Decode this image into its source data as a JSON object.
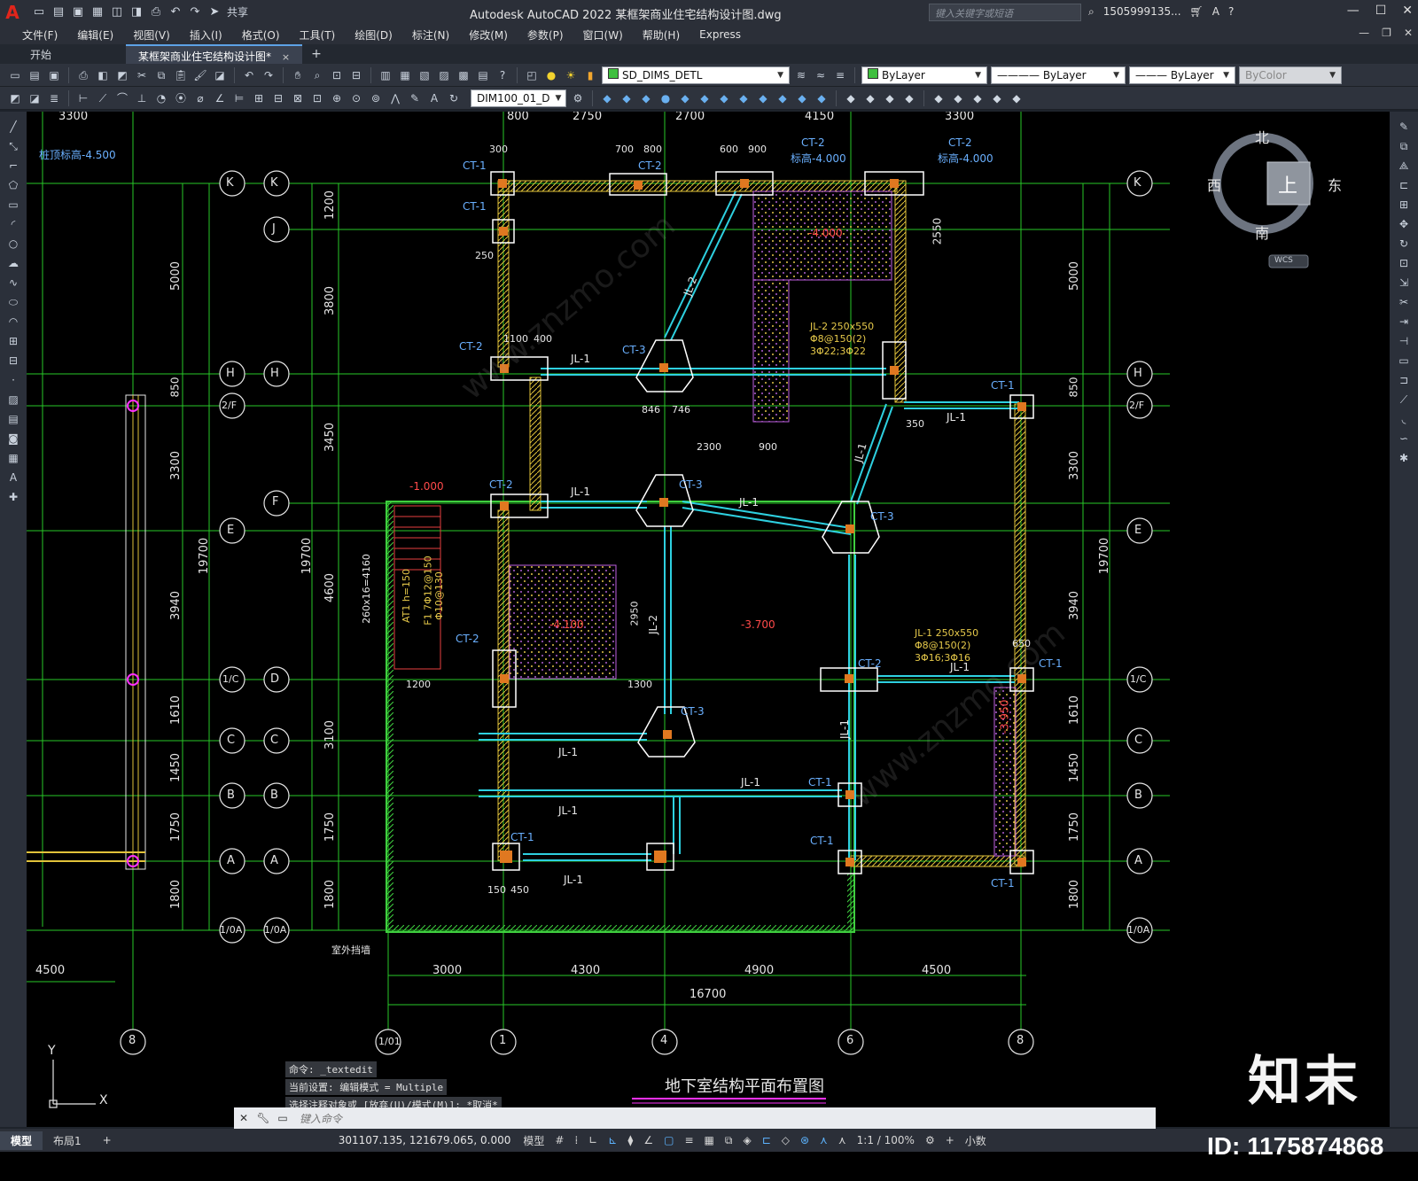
{
  "titlebar": {
    "app_icon": "A",
    "share_label": "共享",
    "title": "Autodesk AutoCAD 2022    某框架商业住宅结构设计图.dwg",
    "search_placeholder": "键入关键字或短语",
    "user": "1505999135...",
    "icons": [
      "new-icon",
      "open-icon",
      "save-icon",
      "saveas-icon",
      "web-open-icon",
      "web-save-icon",
      "print-icon",
      "undo-icon",
      "redo-icon",
      "share-icon"
    ]
  },
  "menu": {
    "items": [
      "文件(F)",
      "编辑(E)",
      "视图(V)",
      "插入(I)",
      "格式(O)",
      "工具(T)",
      "绘图(D)",
      "标注(N)",
      "修改(M)",
      "参数(P)",
      "窗口(W)",
      "帮助(H)",
      "Express"
    ]
  },
  "tabs": {
    "start": "开始",
    "active": "某框架商业住宅结构设计图*",
    "close": "×",
    "add": "+"
  },
  "toolbar1": {
    "layer": "SD_DIMS_DETL",
    "layer_color": "#3fbf3f",
    "color_dd": "ByLayer",
    "color_swatch": "#3fbf3f",
    "linetype_dd": "ByLayer",
    "lineweight_dd": "ByLayer",
    "plotstyle_dd": "ByColor"
  },
  "toolbar2": {
    "dimstyle": "DIM100_01_D"
  },
  "viewcube": {
    "north": "北",
    "south": "南",
    "east": "东",
    "west": "西",
    "face": "上",
    "wcs": "WCS"
  },
  "drawing": {
    "title": "地下室结构平面布置图",
    "left_dim_top": "3300",
    "top_dims": [
      "800",
      "2750",
      "2700",
      "4150",
      "3300"
    ],
    "pile_top_label": "桩顶标高-4.500",
    "axis_right": [
      "K",
      "H",
      "2/F",
      "E",
      "1/C",
      "C",
      "B",
      "A",
      "1/0A"
    ],
    "axis_mid": [
      "K",
      "J",
      "H",
      "F",
      "D",
      "C",
      "B",
      "A",
      "1/0A"
    ],
    "axis_left": [
      "K",
      "H",
      "2/F",
      "E",
      "1/C",
      "C",
      "B",
      "A",
      "1/0A"
    ],
    "axis_bottom": [
      "8",
      "1/01",
      "1",
      "4",
      "6",
      "8"
    ],
    "bottom_dims_1": [
      "3000",
      "4300",
      "4900",
      "4500"
    ],
    "bottom_dim_total": "16700",
    "left_bottom_dim": "4500",
    "vert_dims_left": [
      "5000",
      "850",
      "3300",
      "3940",
      "1610",
      "1450",
      "1750",
      "1800"
    ],
    "vert_total": "19700",
    "vert_dims_mid": [
      "1200",
      "3800",
      "3450",
      "4600",
      "3100",
      "1750",
      "1800"
    ],
    "vert_dims_right": [
      "2550",
      "5000",
      "850",
      "3300",
      "3940",
      "1610",
      "1450",
      "1750",
      "1800"
    ],
    "ct_labels": [
      "CT-1",
      "CT-1",
      "CT-2",
      "CT-2",
      "CT-2",
      "CT-2",
      "CT-3",
      "CT-3",
      "CT-3",
      "CT-3",
      "CT-2",
      "CT-1",
      "CT-1",
      "CT-1",
      "CT-1",
      "CT-1",
      "CT-1",
      "CT-2",
      "CT-2"
    ],
    "jl_labels": [
      "JL-1",
      "JL-1",
      "JL-1",
      "JL-1",
      "JL-1",
      "JL-1",
      "JL-1",
      "JL-1",
      "JL-1",
      "JL-2",
      "JL-2",
      "JL-1",
      "JL-1"
    ],
    "jl2_note": [
      "JL-2 250x550",
      "Φ8@150(2)",
      "3Φ22;3Φ22"
    ],
    "jl1_note": [
      "JL-1 250x550",
      "Φ8@150(2)",
      "3Φ16;3Φ16"
    ],
    "level_labels": [
      "-4.000",
      "-4.100",
      "-3.700",
      "-1.000",
      "-3.950"
    ],
    "ct2_level": [
      "标高-4.000",
      "标高-4.000"
    ],
    "stair_note": [
      "260x16=4160",
      "AT1 h=150",
      "F1 7Φ12@150",
      "Φ10@130"
    ],
    "outdoor": "室外挡墙",
    "sub_dims": [
      "846",
      "746",
      "1300",
      "2300",
      "900",
      "1200",
      "1100",
      "400",
      "700",
      "800",
      "600",
      "900",
      "300",
      "250",
      "350",
      "450",
      "150",
      "650",
      "2950",
      "3.950"
    ]
  },
  "commandline": {
    "history": [
      "命令: _textedit",
      "当前设置: 编辑模式 = Multiple",
      "选择注释对象或 [放弃(U)/模式(M)]: *取消*"
    ],
    "placeholder": "键入命令"
  },
  "statusbar": {
    "tab_model": "模型",
    "tab_layout": "布局1",
    "add": "+",
    "coords": "301107.135, 121679.065, 0.000",
    "model_btn": "模型",
    "scale": "1:1 / 100%",
    "units": "小数"
  },
  "watermark": {
    "brand": "知末",
    "id": "ID: 1175874868",
    "site": "www.znzmo.com"
  }
}
